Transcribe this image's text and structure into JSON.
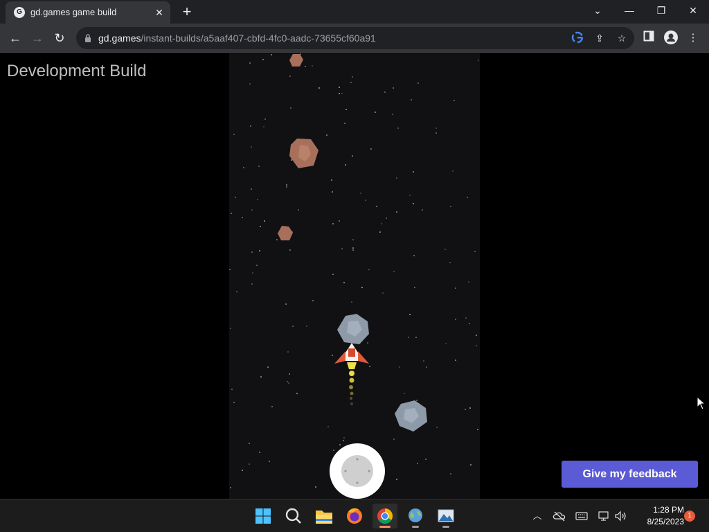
{
  "browser": {
    "tab": {
      "title": "gd.games game build",
      "favicon": "gdevelop-logo-icon",
      "close": "✕"
    },
    "new_tab": "+",
    "window_controls": {
      "tab_search": "⌄",
      "minimize": "—",
      "restore": "❐",
      "close": "✕"
    },
    "nav": {
      "back": "←",
      "forward": "→",
      "reload": "↻"
    },
    "url": {
      "host": "gd.games",
      "path": "/instant-builds/a5aaf407-cbfd-4fc0-aadc-73655cf60a91"
    },
    "omnibox_icons": [
      "google-lens-icon",
      "share-icon",
      "bookmark-star-icon"
    ],
    "toolbar_icons": [
      "side-panel-icon",
      "profile-icon",
      "menu-icon"
    ]
  },
  "page": {
    "dev_label": "Development Build",
    "feedback_button": "Give my feedback",
    "game": {
      "player": "spaceship",
      "asteroids": [
        {
          "type": "rock",
          "color": "#a8705a"
        },
        {
          "type": "rock",
          "color": "#a8705a"
        },
        {
          "type": "rock",
          "color": "#a8705a"
        },
        {
          "type": "ice",
          "color": "#8e9aa8"
        },
        {
          "type": "ice",
          "color": "#8e9aa8"
        }
      ],
      "control": "virtual-joystick"
    }
  },
  "taskbar": {
    "apps": [
      "start-icon",
      "search-icon",
      "file-explorer-icon",
      "firefox-icon",
      "chrome-icon",
      "globe-app-icon",
      "photos-app-icon"
    ],
    "active_app": "chrome-icon",
    "tray": [
      "show-hidden-icons-chevron",
      "onedrive-icon",
      "keyboard-icon",
      "network-icon",
      "volume-icon"
    ],
    "time": "1:28 PM",
    "date": "8/25/2023",
    "notification_count": "1"
  },
  "colors": {
    "chrome_bg": "#202124",
    "toolbar_bg": "#35363a",
    "game_bg": "#111114",
    "feedback_accent": "#5b5bd6",
    "taskbar_bg": "#1c1c1c"
  }
}
